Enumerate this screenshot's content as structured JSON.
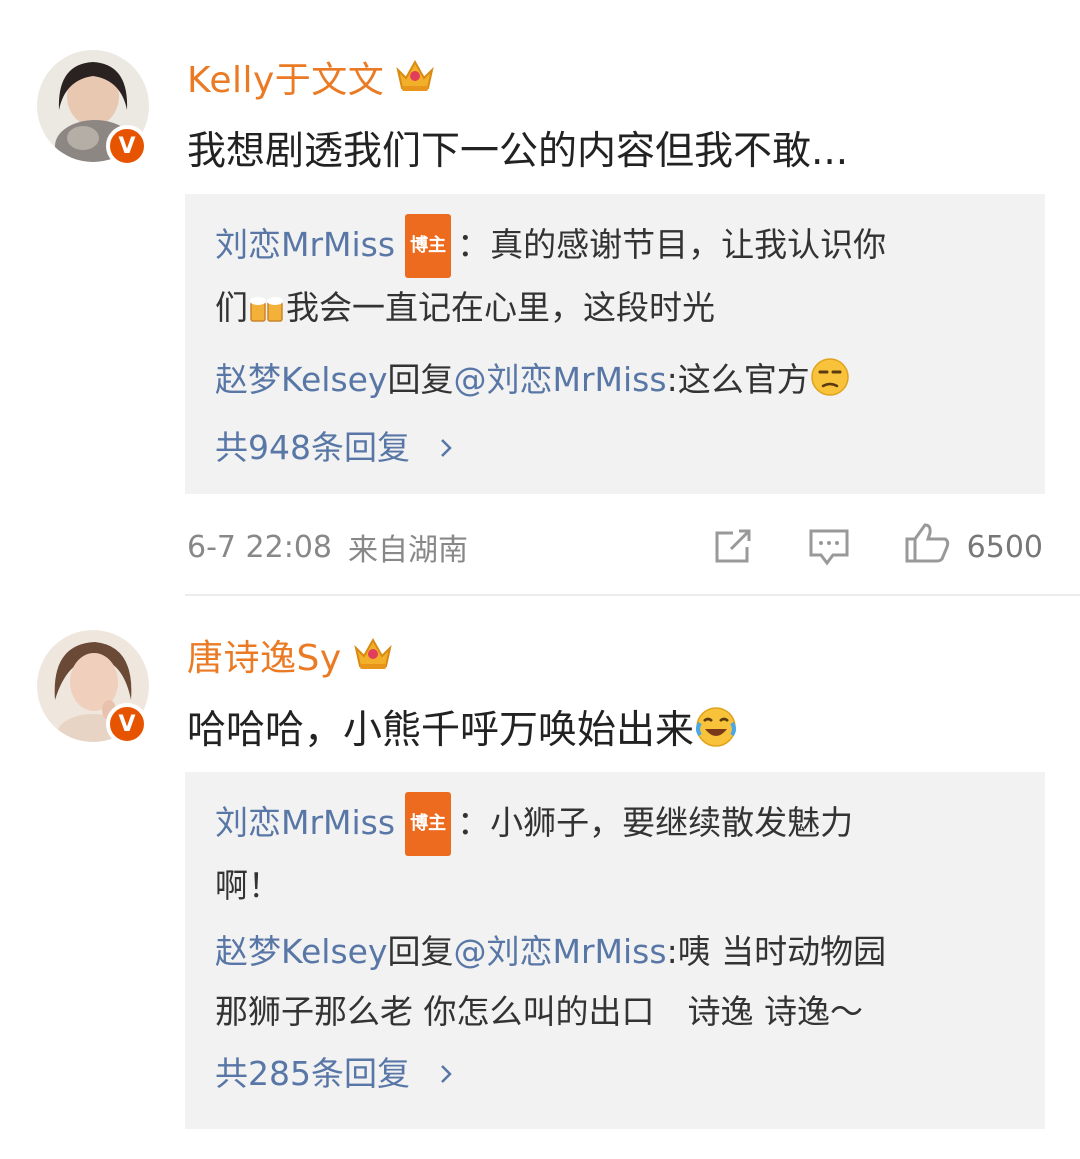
{
  "comments": [
    {
      "username": "Kelly于文文",
      "content": "我想剧透我们下一公的内容但我不敢...",
      "verified_badge": "V",
      "replies": [
        {
          "name": "刘恋MrMiss",
          "badge": "博主",
          "sep": "：",
          "text_line1": "真的感谢节目，让我认识你",
          "text_line2_a": "们",
          "text_line2_b": "我会一直记在心里，这段时光"
        },
        {
          "name": "赵梦Kelsey",
          "reply_word": "回复",
          "mention": "@刘恋MrMiss",
          "text": ":这么官方"
        }
      ],
      "more_replies": "共948条回复",
      "time": "6-7 22:08",
      "location": "来自湖南",
      "likes": "6500"
    },
    {
      "username": "唐诗逸Sy",
      "content": "哈哈哈，小熊千呼万唤始出来",
      "verified_badge": "V",
      "replies": [
        {
          "name": "刘恋MrMiss",
          "badge": "博主",
          "sep": "：",
          "text_line1": "小狮子，要继续散发魅力",
          "text_line2": "啊！"
        },
        {
          "name": "赵梦Kelsey",
          "reply_word": "回复",
          "mention": "@刘恋MrMiss",
          "text_line1": ":咦 当时动物园",
          "text_line2": "那狮子那么老 你怎么叫的出口　诗逸 诗逸～"
        }
      ],
      "more_replies": "共285条回复"
    }
  ],
  "colors": {
    "username": "#eb7a24",
    "link": "#5877a6",
    "badge": "#ec6b1f",
    "reply_bg": "#f2f2f2",
    "meta": "#888888"
  },
  "icons": [
    "crown-icon",
    "share-icon",
    "comment-icon",
    "like-icon",
    "chevron-right-icon",
    "unamused-emoji-icon",
    "beer-emoji-icon",
    "laughing-crying-emoji-icon"
  ]
}
